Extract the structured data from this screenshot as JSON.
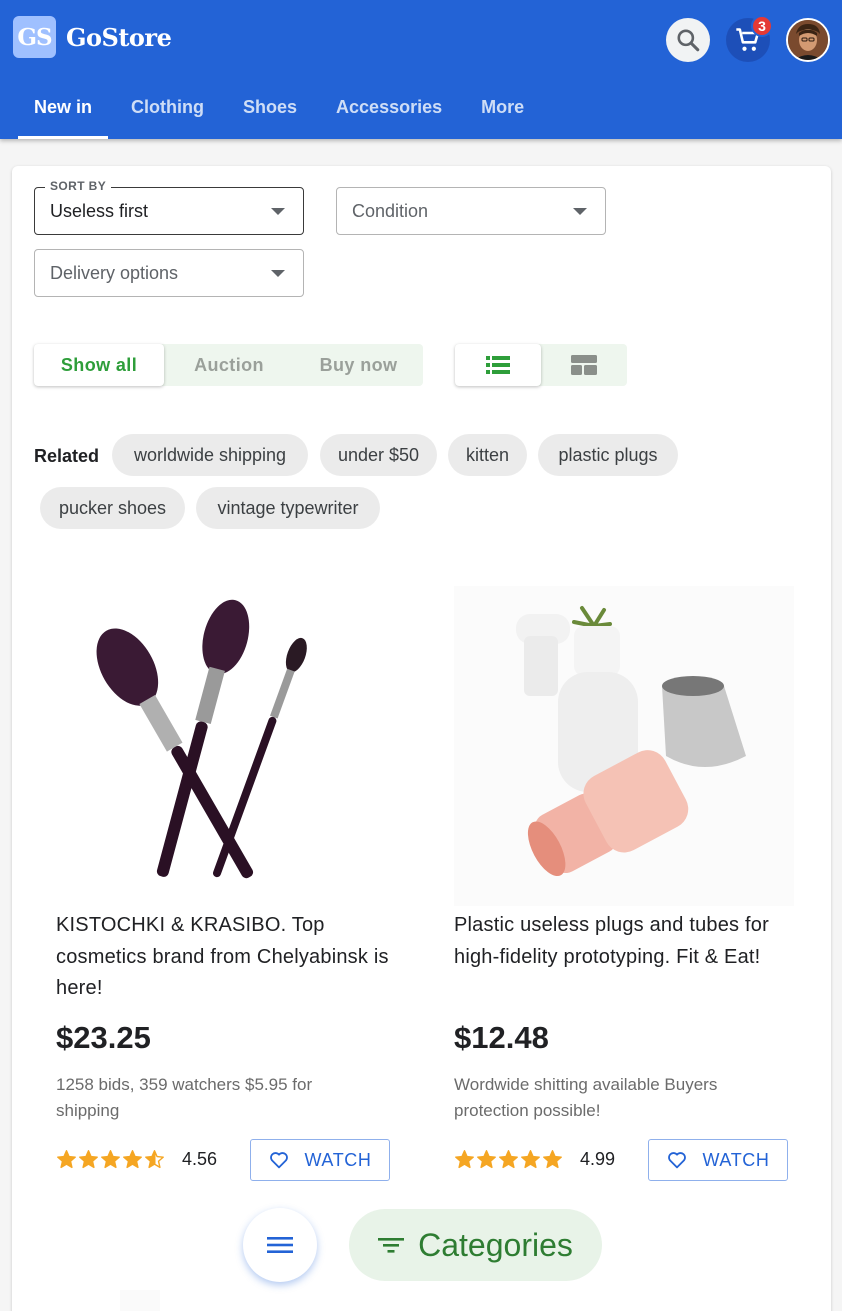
{
  "brand": {
    "logo_text": "GS",
    "name": "GoStore"
  },
  "header": {
    "cart_count": "3"
  },
  "nav": {
    "tabs": [
      "New in",
      "Clothing",
      "Shoes",
      "Accessories",
      "More"
    ],
    "active": "New in"
  },
  "filters": {
    "sort": {
      "label": "SORT BY",
      "value": "Useless first"
    },
    "condition": {
      "placeholder": "Condition"
    },
    "delivery": {
      "placeholder": "Delivery options"
    }
  },
  "listing_type": {
    "options": [
      "Show all",
      "Auction",
      "Buy now"
    ],
    "selected": "Show all"
  },
  "view_mode": {
    "options": [
      "list-view-icon",
      "grid-view-icon"
    ],
    "selected": "list-view-icon"
  },
  "related": {
    "label": "Related",
    "chips": [
      "worldwide shipping",
      "under $50",
      "kitten",
      "plastic plugs",
      "pucker shoes",
      "vintage typewriter"
    ]
  },
  "products": [
    {
      "title": "KISTOCHKI & KRASIBO. Top cosmetics brand from Chelyabinsk is here!",
      "price": "$23.25",
      "meta": "1258 bids, 359 watchers $5.95 for shipping",
      "rating": "4.56",
      "stars": 4.56,
      "watch_label": "WATCH"
    },
    {
      "title": "Plastic useless plugs and tubes for high-fidelity prototyping. Fit & Eat!",
      "price": "$12.48",
      "meta": "Wordwide shitting available Buyers protection possible!",
      "rating": "4.99",
      "stars": 4.99,
      "watch_label": "WATCH"
    }
  ],
  "bottom": {
    "categories_label": "Categories"
  },
  "colors": {
    "primary": "#2363d6",
    "accent_green": "#2e9e3a",
    "star": "#f5a623",
    "badge": "#e53935"
  }
}
